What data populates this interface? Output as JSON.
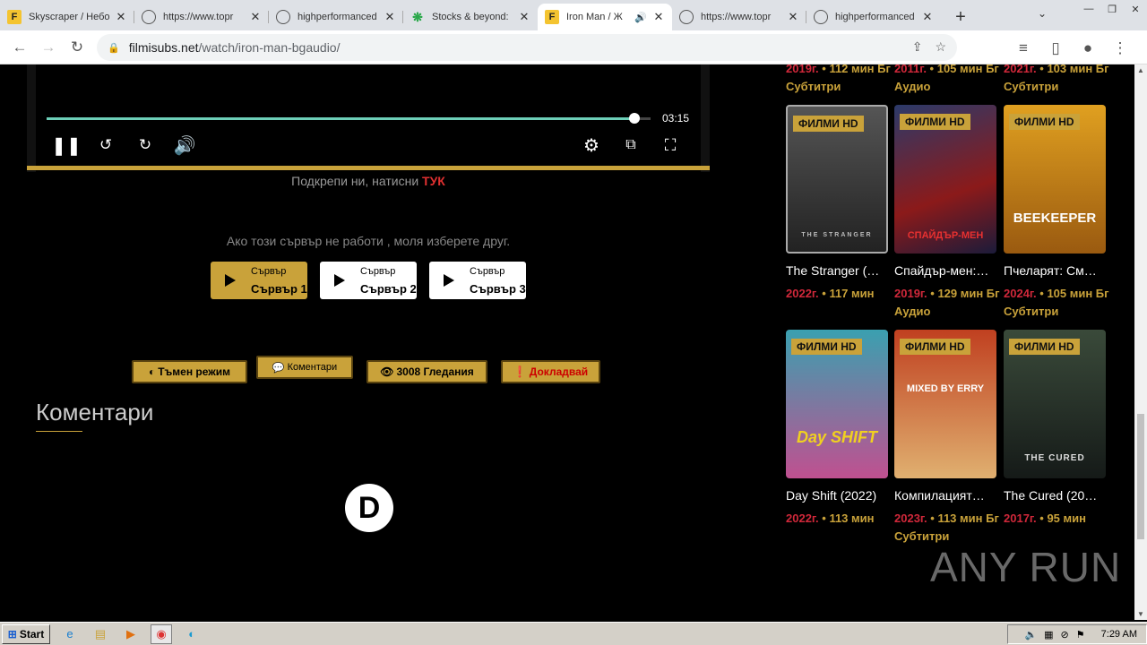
{
  "browser": {
    "tabs": [
      {
        "title": "Skyscraper / Небо",
        "icon": "filmisubs-icon",
        "active": false
      },
      {
        "title": "https://www.topr",
        "icon": "globe-icon",
        "active": false
      },
      {
        "title": "highperformanced",
        "icon": "globe-icon",
        "active": false
      },
      {
        "title": "Stocks & beyond:",
        "icon": "stocks-icon",
        "active": false
      },
      {
        "title": "Iron Man / Ж",
        "icon": "filmisubs-icon",
        "active": true
      },
      {
        "title": "https://www.topr",
        "icon": "globe-icon",
        "active": false
      },
      {
        "title": "highperformanced",
        "icon": "globe-icon",
        "active": false
      }
    ],
    "url_domain": "filmisubs.net",
    "url_path": "/watch/iron-man-bgaudio/"
  },
  "player": {
    "time": "03:15",
    "progress_fraction": 0.975
  },
  "support": {
    "text": "Подкрепи ни, натисни ",
    "link": "ТУК"
  },
  "servers": {
    "message": "Ако този сървър не работи , моля изберете друг.",
    "items": [
      {
        "label": "Сървър",
        "name": "Сървър 1",
        "active": true
      },
      {
        "label": "Сървър",
        "name": "Сървър 2",
        "active": false
      },
      {
        "label": "Сървър",
        "name": "Сървър 3",
        "active": false
      }
    ]
  },
  "actions": {
    "dark_mode": "Тъмен режим",
    "comments": "Коментари",
    "views": "3008 Гледания",
    "report": "Докладвай"
  },
  "comments_heading": "Коментари",
  "sidebar": {
    "top_row": [
      {
        "year": "2019г.",
        "meta": "112 мин Бг",
        "meta2": "Субтитри"
      },
      {
        "year": "2011г.",
        "meta": "105 мин Бг Аудио",
        "meta2": ""
      },
      {
        "year": "2021г.",
        "meta": "103 мин Бг",
        "meta2": "Субтитри"
      }
    ],
    "row2": [
      {
        "badge": "ФИЛМИ HD",
        "poster_text": "THE STRANGER",
        "title": "The Stranger (…",
        "year": "2022г.",
        "meta": "117 мин",
        "meta2": ""
      },
      {
        "badge": "ФИЛМИ HD",
        "poster_text": "СПАЙДЪР-МЕН",
        "title": "Спайдър-мен:…",
        "year": "2019г.",
        "meta": "129 мин Бг Аудио",
        "meta2": ""
      },
      {
        "badge": "ФИЛМИ HD",
        "poster_text": "BEEKEEPER",
        "title": "Пчеларят: См…",
        "year": "2024г.",
        "meta": "105 мин Бг",
        "meta2": "Субтитри"
      }
    ],
    "row3": [
      {
        "badge": "ФИЛМИ HD",
        "poster_text": "Day SHIFT",
        "title": "Day Shift (2022)",
        "year": "2022г.",
        "meta": "113 мин",
        "meta2": ""
      },
      {
        "badge": "ФИЛМИ HD",
        "poster_text": "MIXED BY ERRY",
        "title": "Компилацият…",
        "year": "2023г.",
        "meta": "113 мин Бг",
        "meta2": "Субтитри"
      },
      {
        "badge": "ФИЛМИ HD",
        "poster_text": "THE CURED",
        "title": "The Cured (20…",
        "year": "2017г.",
        "meta": "95 мин",
        "meta2": ""
      }
    ]
  },
  "watermark": "ANY RUN",
  "taskbar": {
    "start": "Start",
    "clock": "7:29 AM"
  },
  "colors": {
    "accent": "#c9a23a",
    "year_red": "#d0283a",
    "progress": "#6dcfb8"
  }
}
